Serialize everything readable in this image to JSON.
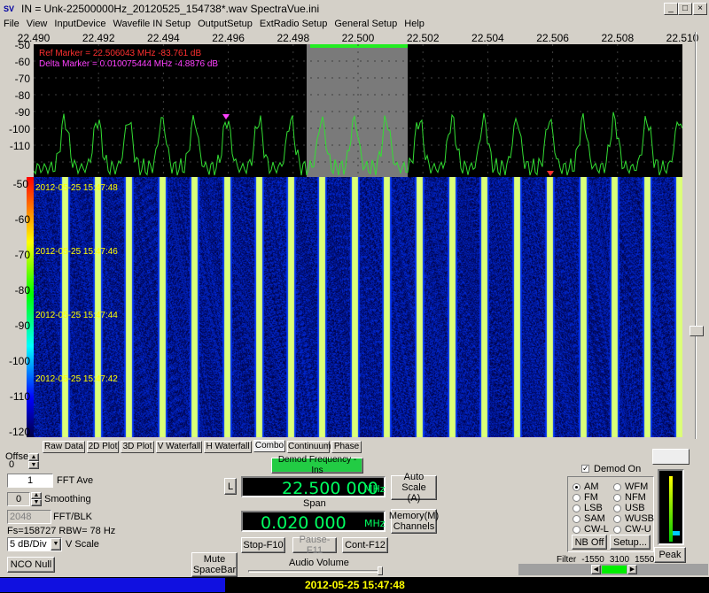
{
  "window": {
    "title": "IN = Unk-22500000Hz_20120525_154738*.wav   SpectraVue.ini"
  },
  "menu": [
    "File",
    "View",
    "InputDevice",
    "Wavefile IN Setup",
    "OutputSetup",
    "ExtRadio Setup",
    "General Setup",
    "Help"
  ],
  "freq_axis": [
    "22.490",
    "22.492",
    "22.494",
    "22.496",
    "22.498",
    "22.500",
    "22.502",
    "22.504",
    "22.506",
    "22.508",
    "22.510"
  ],
  "spectrum": {
    "y_ticks": [
      "-50",
      "-60",
      "-70",
      "-80",
      "-90",
      "-100",
      "-110"
    ],
    "ref_marker": "Ref Marker =  22.506043 MHz  -83.761 dB",
    "delta_marker": "Delta Marker =  0.010075444 MHz  -4.8876 dB",
    "trace_color": "#33dd33",
    "marker_ref_color": "#ff3030",
    "marker_delta_color": "#ff40ff"
  },
  "waterfall": {
    "y_ticks": [
      "-50",
      "-60",
      "-70",
      "-80",
      "-90",
      "-100",
      "-110",
      "-120"
    ],
    "timestamps": [
      "2012-05-25 15:47:48",
      "2012-05-25 15:47:46",
      "2012-05-25 15:47:44",
      "2012-05-25 15:47:42"
    ]
  },
  "tabs": [
    "Raw Data",
    "2D Plot",
    "3D Plot",
    "V Waterfall",
    "H Waterfall",
    "Combo",
    "Continuum",
    "Phase"
  ],
  "tabs_active": "Combo",
  "controls": {
    "offset_label": "Offset",
    "offset_value": "0",
    "fft_ave_value": "1",
    "fft_ave_label": "FFT Ave",
    "smoothing_value": "0",
    "smoothing_label": "Smoothing",
    "fft_blk_value": "2048",
    "fft_blk_label": "FFT/BLK",
    "fs_info": "Fs=158727 RBW=  78 Hz",
    "vscale_value": "5 dB/Div",
    "vscale_label": "V Scale",
    "nco_null": "NCO Null",
    "demod_freq_label": "Demod Frequency - Ins",
    "l_button": "L",
    "demod_freq": "22.500 000",
    "mhz": "MHz",
    "span_label": "Span",
    "span_value": "0.020 000",
    "auto_scale": "Auto Scale",
    "auto_scale_sub": "(A)",
    "memory": "Memory(M)",
    "channels": "Channels",
    "stop": "Stop-F10",
    "pause": "Pause-F11",
    "cont": "Cont-F12",
    "mute": "Mute",
    "mute_sub": "SpaceBar",
    "audio_volume": "Audio Volume",
    "demod_on": "Demod On",
    "modes": [
      "AM",
      "WFM",
      "FM",
      "NFM",
      "LSB",
      "USB",
      "SAM",
      "WUSB",
      "CW-L",
      "CW-U"
    ],
    "mode_selected": "AM",
    "nb_off": "NB Off",
    "setup": "Setup...",
    "peak": "Peak",
    "filter_label": "Filter",
    "filter_low": "-1550",
    "filter_width": "3100",
    "filter_high": "1550"
  },
  "status": {
    "timestamp": "2012-05-25 15:47:48"
  }
}
